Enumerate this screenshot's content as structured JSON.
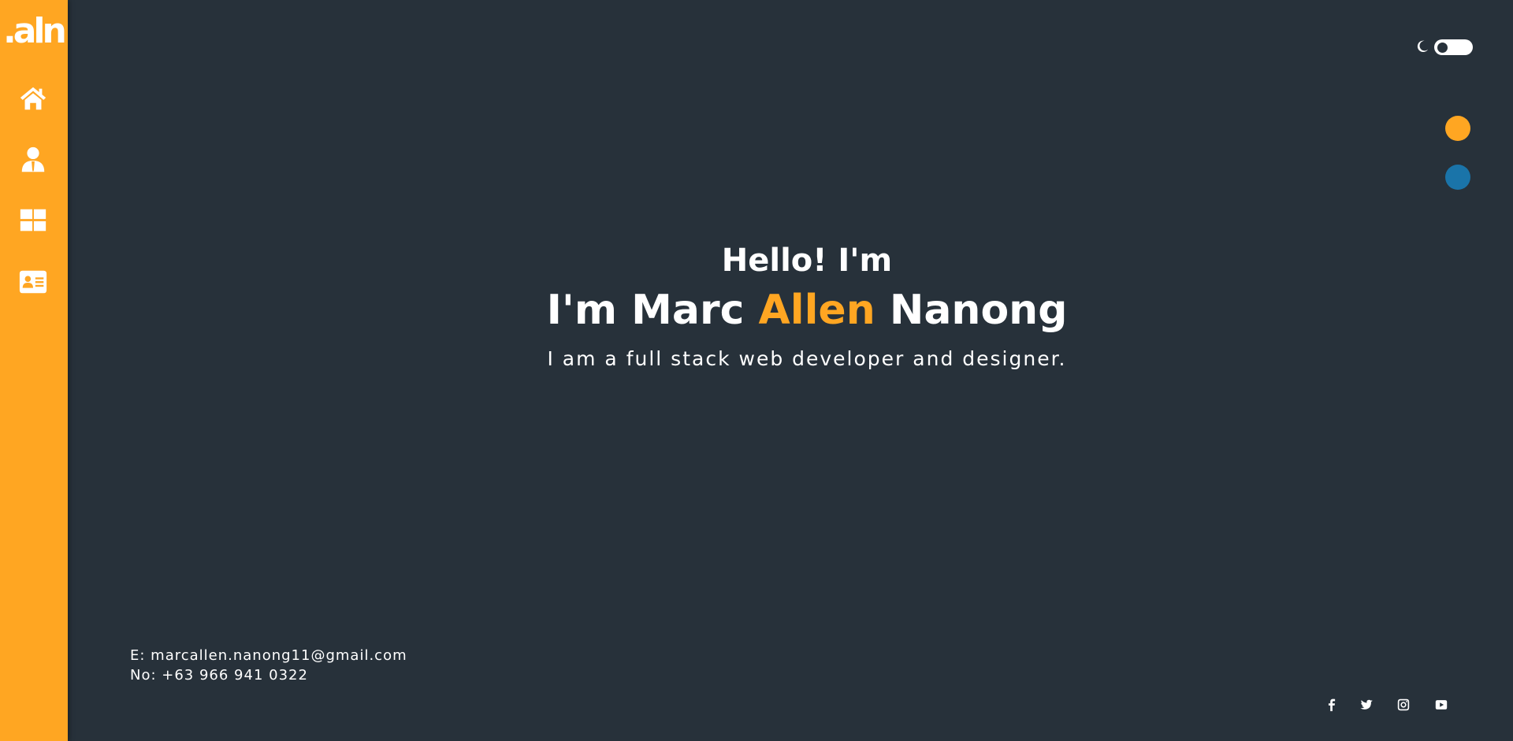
{
  "sidebar": {
    "logo_text": ".aln",
    "nav": [
      {
        "icon": "home-icon",
        "label": "Home"
      },
      {
        "icon": "user-icon",
        "label": "About"
      },
      {
        "icon": "grid-icon",
        "label": "Portfolio"
      },
      {
        "icon": "contact-card-icon",
        "label": "Contact"
      }
    ],
    "background_color": "#ffa622"
  },
  "theme_toggle": {
    "icon": "moon-icon",
    "state": "dark"
  },
  "color_swatches": [
    "#ffa622",
    "#1a74a9"
  ],
  "hero": {
    "greeting": "Hello! I'm",
    "name_prefix": "I'm Marc ",
    "name_accent": "Allen",
    "name_suffix": " Nanong",
    "tagline": "I am a full stack web developer and designer.",
    "accent_color": "#ffa622"
  },
  "contact": {
    "email_line": "E: marcallen.nanong11@gmail.com",
    "phone_line": "No: +63 966 941 0322"
  },
  "social": [
    "facebook-icon",
    "twitter-icon",
    "instagram-icon",
    "youtube-icon"
  ],
  "colors": {
    "background": "#27313a",
    "text": "#ffffff"
  }
}
